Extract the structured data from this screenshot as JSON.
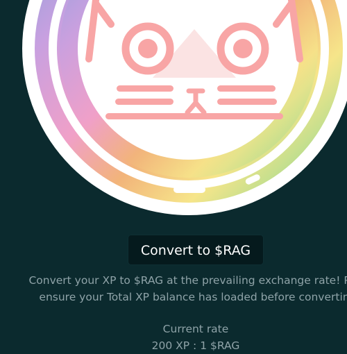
{
  "hero": {
    "logo_name": "cat-face-logo",
    "ring_gradient": [
      "#7da2d8",
      "#f0a0c8",
      "#f2b47a",
      "#f6e58a",
      "#a8dc90",
      "#7fd0c8"
    ],
    "face_color": "#f8a5a5"
  },
  "cta": {
    "label": "Convert to $RAG"
  },
  "description": {
    "line1": "Convert your XP to $RAG at the prevailing exchange rate! Ple",
    "line2": "ensure your Total XP balance has loaded before convertin"
  },
  "rate": {
    "title": "Current rate",
    "value": "200 XP : 1 $RAG"
  },
  "colors": {
    "background": "#0b2a2e",
    "button_bg": "#051a1d",
    "text_muted": "#8fa3a8"
  }
}
